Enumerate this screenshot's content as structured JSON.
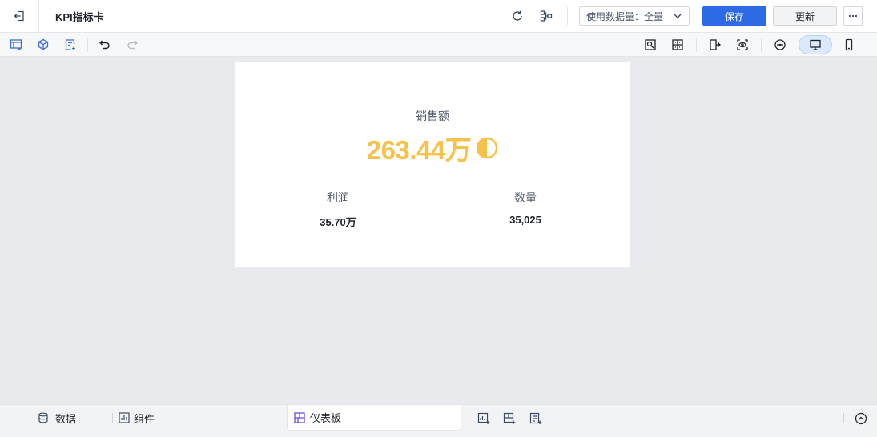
{
  "header": {
    "title": "KPI指标卡",
    "data_scope_label": "使用数据量：全量",
    "save_label": "保存",
    "update_label": "更新",
    "more_label": "···"
  },
  "kpi": {
    "main_label": "销售额",
    "main_value": "263.44万",
    "main_progress": 0.5,
    "sub_items": [
      {
        "label": "利润",
        "value": "35.70万"
      },
      {
        "label": "数量",
        "value": "35,025"
      }
    ]
  },
  "bottom": {
    "data_tab": "数据",
    "component_tab": "组件",
    "dashboard_tab": "仪表板"
  },
  "colors": {
    "accent": "#2d6be4",
    "kpi_value": "#f7c24b",
    "icon": "#3b4a63",
    "toolbar_icon": "#3d6fd1"
  }
}
